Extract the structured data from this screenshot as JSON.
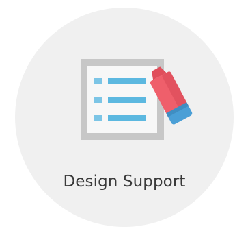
{
  "card": {
    "title": "Design Support",
    "icon": "checklist-with-marker-icon"
  },
  "colors": {
    "circle_background": "#f0f0f0",
    "sheet_border": "#c7c7c7",
    "sheet_fill": "#f7f7f7",
    "list_lines": "#5cb8e0",
    "marker_body": "#ef5f6b",
    "marker_cap": "#4a9fd6",
    "text": "#3a3a3a"
  }
}
